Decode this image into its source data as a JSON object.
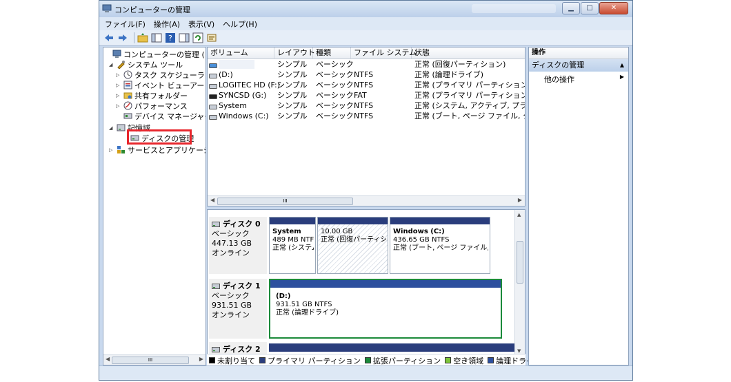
{
  "window": {
    "title": "コンピューターの管理"
  },
  "menu": [
    "ファイル(F)",
    "操作(A)",
    "表示(V)",
    "ヘルプ(H)"
  ],
  "tree": [
    {
      "label": "コンピューターの管理 (ローカ",
      "icon": "computer-icon",
      "level": 0,
      "arrow": ""
    },
    {
      "label": "システム ツール",
      "icon": "tools-icon",
      "level": 1,
      "arrow": "◢"
    },
    {
      "label": "タスク スケジューラ",
      "icon": "clock-icon",
      "level": 2,
      "arrow": "▷"
    },
    {
      "label": "イベント ビューアー",
      "icon": "event-viewer-icon",
      "level": 2,
      "arrow": "▷"
    },
    {
      "label": "共有フォルダー",
      "icon": "shared-folder-icon",
      "level": 2,
      "arrow": "▷"
    },
    {
      "label": "パフォーマンス",
      "icon": "performance-icon",
      "level": 2,
      "arrow": "▷"
    },
    {
      "label": "デバイス マネージャー",
      "icon": "device-manager-icon",
      "level": 2,
      "arrow": ""
    },
    {
      "label": "記憶域",
      "icon": "storage-icon",
      "level": 1,
      "arrow": "◢"
    },
    {
      "label": "ディスクの管理",
      "icon": "disk-management-icon",
      "level": 2,
      "arrow": ""
    },
    {
      "label": "サービスとアプリケーション",
      "icon": "services-icon",
      "level": 1,
      "arrow": "▷"
    }
  ],
  "columns": [
    "ボリューム",
    "レイアウト",
    "種類",
    "ファイル システム",
    "状態"
  ],
  "volumes": [
    {
      "name": "",
      "layout": "シンプル",
      "type": "ベーシック",
      "fs": "",
      "status": "正常 (回復パーティション)"
    },
    {
      "name": "(D:)",
      "layout": "シンプル",
      "type": "ベーシック",
      "fs": "NTFS",
      "status": "正常 (論理ドライブ)"
    },
    {
      "name": "LOGITEC HD (F:)",
      "layout": "シンプル",
      "type": "ベーシック",
      "fs": "NTFS",
      "status": "正常 (プライマリ パーティション)"
    },
    {
      "name": "SYNCSD (G:)",
      "layout": "シンプル",
      "type": "ベーシック",
      "fs": "FAT",
      "status": "正常 (プライマリ パーティション)"
    },
    {
      "name": "System",
      "layout": "シンプル",
      "type": "ベーシック",
      "fs": "NTFS",
      "status": "正常 (システム, アクティブ, プライマ"
    },
    {
      "name": "Windows (C:)",
      "layout": "シンプル",
      "type": "ベーシック",
      "fs": "NTFS",
      "status": "正常 (ブート, ページ ファイル, クラッ"
    }
  ],
  "disks": [
    {
      "name": "ディスク 0",
      "type": "ベーシック",
      "size": "447.13 GB",
      "state": "オンライン",
      "partitions": [
        {
          "title": "System",
          "size": "489 MB NTFS",
          "status": "正常 (システム"
        },
        {
          "title": "",
          "size": "10.00 GB",
          "status": "正常 (回復パーティシ"
        },
        {
          "title": "Windows  (C:)",
          "size": "436.65 GB NTFS",
          "status": "正常 (ブート, ページ ファイル, ‹"
        }
      ]
    },
    {
      "name": "ディスク 1",
      "type": "ベーシック",
      "size": "931.51 GB",
      "state": "オンライン",
      "partitions": [
        {
          "title": "(D:)",
          "size": "931.51 GB NTFS",
          "status": "正常 (論理ドライブ)"
        }
      ]
    },
    {
      "name": "ディスク 2"
    }
  ],
  "legend": [
    {
      "label": "未割り当て",
      "color": "#000000"
    },
    {
      "label": "プライマリ パーティション",
      "color": "#2a3d7c"
    },
    {
      "label": "拡張パーティション",
      "color": "#1b8a3a"
    },
    {
      "label": "空き領域",
      "color": "#7ec63a"
    },
    {
      "label": "論理ドライブ",
      "color": "#2d4f9e"
    }
  ],
  "actions": {
    "header": "操作",
    "section": "ディスクの管理",
    "item": "他の操作"
  },
  "scroll": {
    "thumb": "III"
  },
  "colors": {
    "highlight": "#e8262c",
    "logical_border": "#1b8a3a",
    "primary_bar": "#2a3d7c"
  }
}
